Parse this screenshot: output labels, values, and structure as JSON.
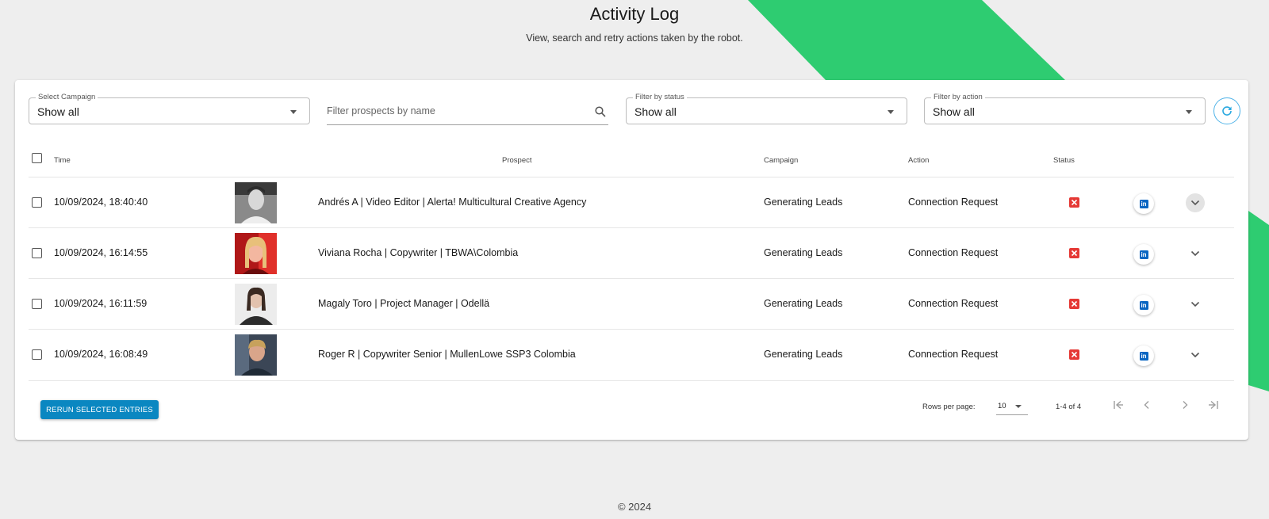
{
  "header": {
    "title": "Activity Log",
    "subtitle": "View, search and retry actions taken by the robot."
  },
  "filters": {
    "campaign": {
      "label": "Select Campaign",
      "value": "Show all"
    },
    "search": {
      "placeholder": "Filter prospects by name"
    },
    "status": {
      "label": "Filter by status",
      "value": "Show all"
    },
    "action": {
      "label": "Filter by action",
      "value": "Show all"
    }
  },
  "table": {
    "columns": {
      "time": "Time",
      "prospect": "Prospect",
      "campaign": "Campaign",
      "action": "Action",
      "status": "Status"
    },
    "rows": [
      {
        "time": "10/09/2024, 18:40:40",
        "prospect": "Andrés A | Video Editor  | Alerta! Multicultural Creative Agency",
        "campaign": "Generating Leads",
        "action": "Connection Request"
      },
      {
        "time": "10/09/2024, 16:14:55",
        "prospect": "Viviana Rocha | Copywriter  | TBWA\\Colombia",
        "campaign": "Generating Leads",
        "action": "Connection Request"
      },
      {
        "time": "10/09/2024, 16:11:59",
        "prospect": "Magaly Toro | Project Manager  | Odellä",
        "campaign": "Generating Leads",
        "action": "Connection Request"
      },
      {
        "time": "10/09/2024, 16:08:49",
        "prospect": "Roger R | Copywriter Senior  | MullenLowe SSP3 Colombia",
        "campaign": "Generating Leads",
        "action": "Connection Request"
      }
    ]
  },
  "footer": {
    "rerun_label": "RERUN SELECTED ENTRIES",
    "rows_per_page_label": "Rows per page:",
    "rows_per_page_value": "10",
    "range_text": "1-4 of 4"
  },
  "copyright": "© 2024",
  "colors": {
    "accent_green": "#2ecc71",
    "button_blue": "#0a87c1",
    "status_red": "#e53935",
    "linkedin_blue": "#0a66c2"
  }
}
